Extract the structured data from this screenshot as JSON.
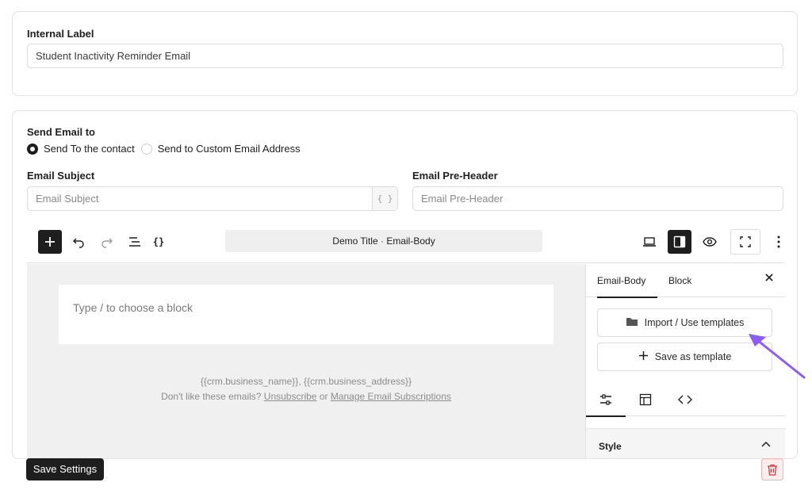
{
  "internal_label": {
    "label": "Internal Label",
    "value": "Student Inactivity Reminder Email"
  },
  "send_email": {
    "label": "Send Email to",
    "options": [
      {
        "label": "Send To the contact",
        "selected": true
      },
      {
        "label": "Send to Custom Email Address",
        "selected": false
      }
    ]
  },
  "email_subject": {
    "label": "Email Subject",
    "placeholder": "Email Subject",
    "var_button": "{ }"
  },
  "email_preheader": {
    "label": "Email Pre-Header",
    "placeholder": "Email Pre-Header"
  },
  "toolbar": {
    "add_icon": "plus-icon",
    "undo_icon": "undo-icon",
    "redo_icon": "redo-icon",
    "list_view_icon": "list-view-icon",
    "code_icon": "braces-icon",
    "document_title": "Demo Title",
    "document_subtitle": "Email-Body",
    "separator": "·",
    "desktop_icon": "laptop-icon",
    "sidebar_toggle_icon": "sidebar-icon",
    "preview_icon": "eye-icon",
    "fullscreen_icon": "fullscreen-icon",
    "more_icon": "more-vertical-icon"
  },
  "canvas": {
    "block_placeholder": "Type / to choose a block",
    "footer_line1": "{{crm.business_name}}, {{crm.business_address}}",
    "footer_prefix": "Don't like these emails? ",
    "unsubscribe": "Unsubscribe",
    "or": " or ",
    "manage": "Manage Email Subscriptions"
  },
  "sidebar": {
    "tabs": [
      "Email-Body",
      "Block"
    ],
    "active_tab": "Email-Body",
    "import_button": "Import / Use templates",
    "save_template_button": "Save as template",
    "icon_tabs": [
      "sliders-icon",
      "layout-icon",
      "code-icon"
    ],
    "style_label": "Style"
  },
  "footer": {
    "save_button": "Save Settings",
    "delete_icon": "trash-icon"
  },
  "colors": {
    "primary_dark": "#1e1e1e",
    "arrow": "#8b5cf6",
    "danger": "#d9363e"
  }
}
